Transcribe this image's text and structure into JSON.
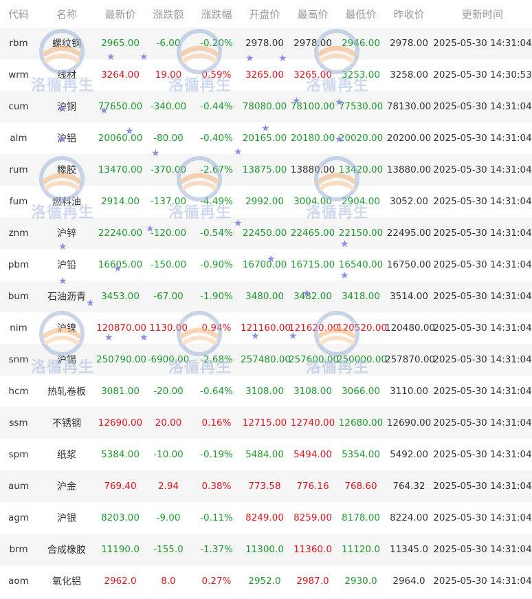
{
  "columns": [
    "代码",
    "名称",
    "最新价",
    "涨跌额",
    "涨跌幅",
    "开盘价",
    "最高价",
    "最低价",
    "昨收价",
    "更新时间"
  ],
  "watermark_text": "洛循再生",
  "colors": {
    "up": "#e1141e",
    "down": "#1f9a2e",
    "neutral": "#333333",
    "header": "#999999",
    "stripe": "#f5f5f5"
  },
  "rows": [
    {
      "code": "rbm",
      "name": "螺纹钢",
      "last": "2965.00",
      "chg": "-6.00",
      "pct": "-0.20%",
      "open": "2978.00",
      "high": "2978.00",
      "low": "2946.00",
      "prev": "2978.00",
      "time": "2025-05-30 14:31:04",
      "dir": "down",
      "c_open": "neutral",
      "c_high": "neutral",
      "c_low": "down"
    },
    {
      "code": "wrm",
      "name": "线材",
      "last": "3264.00",
      "chg": "19.00",
      "pct": "0.59%",
      "open": "3265.00",
      "high": "3265.00",
      "low": "3253.00",
      "prev": "3258.00",
      "time": "2025-05-30 14:30:53",
      "dir": "up",
      "c_open": "up",
      "c_high": "up",
      "c_low": "down"
    },
    {
      "code": "cum",
      "name": "沪铜",
      "last": "77650.00",
      "chg": "-340.00",
      "pct": "-0.44%",
      "open": "78080.00",
      "high": "78100.00",
      "low": "77530.00",
      "prev": "78130.00",
      "time": "2025-05-30 14:31:04",
      "dir": "down",
      "c_open": "down",
      "c_high": "down",
      "c_low": "down"
    },
    {
      "code": "alm",
      "name": "沪铝",
      "last": "20060.00",
      "chg": "-80.00",
      "pct": "-0.40%",
      "open": "20165.00",
      "high": "20180.00",
      "low": "20020.00",
      "prev": "20200.00",
      "time": "2025-05-30 14:31:04",
      "dir": "down",
      "c_open": "down",
      "c_high": "down",
      "c_low": "down"
    },
    {
      "code": "rum",
      "name": "橡胶",
      "last": "13470.00",
      "chg": "-370.00",
      "pct": "-2.67%",
      "open": "13875.00",
      "high": "13880.00",
      "low": "13420.00",
      "prev": "13880.00",
      "time": "2025-05-30 14:31:04",
      "dir": "down",
      "c_open": "down",
      "c_high": "neutral",
      "c_low": "down"
    },
    {
      "code": "fum",
      "name": "燃料油",
      "last": "2914.00",
      "chg": "-137.00",
      "pct": "-4.49%",
      "open": "2992.00",
      "high": "3004.00",
      "low": "2904.00",
      "prev": "3052.00",
      "time": "2025-05-30 14:31:04",
      "dir": "down",
      "c_open": "down",
      "c_high": "down",
      "c_low": "down"
    },
    {
      "code": "znm",
      "name": "沪锌",
      "last": "22240.00",
      "chg": "-120.00",
      "pct": "-0.54%",
      "open": "22450.00",
      "high": "22465.00",
      "low": "22150.00",
      "prev": "22495.00",
      "time": "2025-05-30 14:31:04",
      "dir": "down",
      "c_open": "down",
      "c_high": "down",
      "c_low": "down"
    },
    {
      "code": "pbm",
      "name": "沪铅",
      "last": "16605.00",
      "chg": "-150.00",
      "pct": "-0.90%",
      "open": "16700.00",
      "high": "16715.00",
      "low": "16540.00",
      "prev": "16750.00",
      "time": "2025-05-30 14:31:04",
      "dir": "down",
      "c_open": "down",
      "c_high": "down",
      "c_low": "down"
    },
    {
      "code": "bum",
      "name": "石油沥青",
      "last": "3453.00",
      "chg": "-67.00",
      "pct": "-1.90%",
      "open": "3480.00",
      "high": "3482.00",
      "low": "3418.00",
      "prev": "3514.00",
      "time": "2025-05-30 14:31:04",
      "dir": "down",
      "c_open": "down",
      "c_high": "down",
      "c_low": "down"
    },
    {
      "code": "nim",
      "name": "沪镍",
      "last": "120870.00",
      "chg": "1130.00",
      "pct": "0.94%",
      "open": "121160.00",
      "high": "121620.00",
      "low": "120520.00",
      "prev": "120480.00",
      "time": "2025-05-30 14:31:04",
      "dir": "up",
      "c_open": "up",
      "c_high": "up",
      "c_low": "up"
    },
    {
      "code": "snm",
      "name": "沪锡",
      "last": "250790.00",
      "chg": "-6900.00",
      "pct": "-2.68%",
      "open": "257480.00",
      "high": "257600.00",
      "low": "250000.00",
      "prev": "257870.00",
      "time": "2025-05-30 14:31:04",
      "dir": "down",
      "c_open": "down",
      "c_high": "down",
      "c_low": "down"
    },
    {
      "code": "hcm",
      "name": "热轧卷板",
      "last": "3081.00",
      "chg": "-20.00",
      "pct": "-0.64%",
      "open": "3108.00",
      "high": "3108.00",
      "low": "3066.00",
      "prev": "3110.00",
      "time": "2025-05-30 14:31:04",
      "dir": "down",
      "c_open": "down",
      "c_high": "down",
      "c_low": "down"
    },
    {
      "code": "ssm",
      "name": "不锈钢",
      "last": "12690.00",
      "chg": "20.00",
      "pct": "0.16%",
      "open": "12715.00",
      "high": "12740.00",
      "low": "12680.00",
      "prev": "12690.00",
      "time": "2025-05-30 14:31:04",
      "dir": "up",
      "c_open": "up",
      "c_high": "up",
      "c_low": "down"
    },
    {
      "code": "spm",
      "name": "纸浆",
      "last": "5384.00",
      "chg": "-10.00",
      "pct": "-0.19%",
      "open": "5484.00",
      "high": "5494.00",
      "low": "5354.00",
      "prev": "5492.00",
      "time": "2025-05-30 14:31:04",
      "dir": "down",
      "c_open": "down",
      "c_high": "up",
      "c_low": "down"
    },
    {
      "code": "aum",
      "name": "沪金",
      "last": "769.40",
      "chg": "2.94",
      "pct": "0.38%",
      "open": "773.58",
      "high": "776.16",
      "low": "768.60",
      "prev": "764.32",
      "time": "2025-05-30 14:31:04",
      "dir": "up",
      "c_open": "up",
      "c_high": "up",
      "c_low": "up"
    },
    {
      "code": "agm",
      "name": "沪银",
      "last": "8203.00",
      "chg": "-9.00",
      "pct": "-0.11%",
      "open": "8249.00",
      "high": "8259.00",
      "low": "8178.00",
      "prev": "8224.00",
      "time": "2025-05-30 14:31:04",
      "dir": "down",
      "c_open": "up",
      "c_high": "up",
      "c_low": "down"
    },
    {
      "code": "brm",
      "name": "合成橡胶",
      "last": "11190.0",
      "chg": "-155.0",
      "pct": "-1.37%",
      "open": "11300.0",
      "high": "11360.0",
      "low": "11120.0",
      "prev": "11345.0",
      "time": "2025-05-30 14:31:04",
      "dir": "down",
      "c_open": "down",
      "c_high": "up",
      "c_low": "down"
    },
    {
      "code": "aom",
      "name": "氧化铝",
      "last": "2962.0",
      "chg": "8.0",
      "pct": "0.27%",
      "open": "2952.0",
      "high": "2987.0",
      "low": "2930.0",
      "prev": "2964.0",
      "time": "2025-05-30 14:31:04",
      "dir": "up",
      "c_open": "down",
      "c_high": "up",
      "c_low": "down"
    }
  ]
}
